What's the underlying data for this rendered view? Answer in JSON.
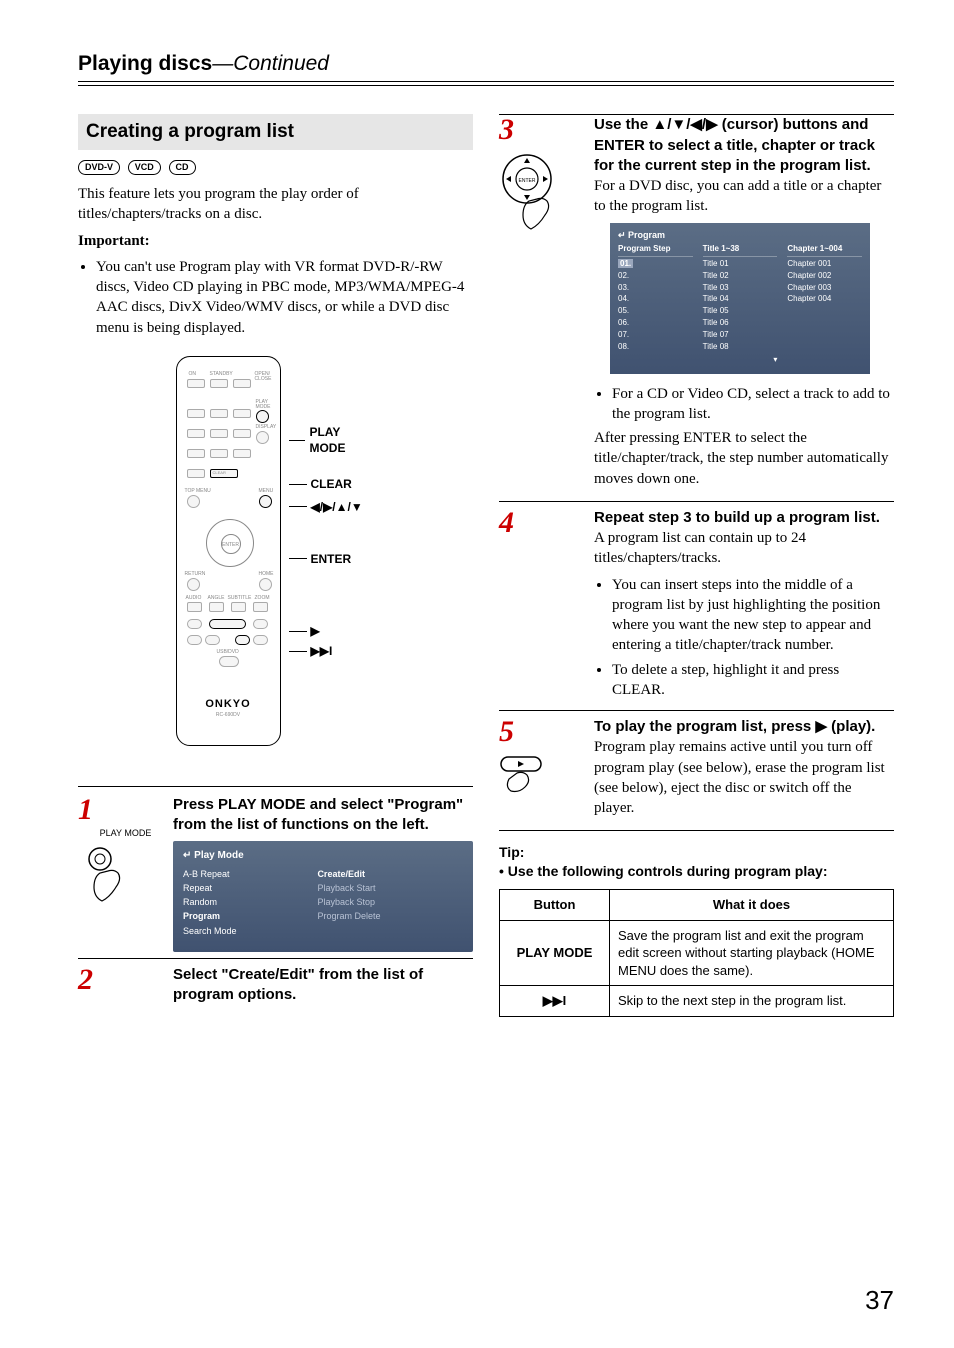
{
  "header": {
    "title": "Playing discs",
    "continued": "—Continued"
  },
  "section": {
    "title": "Creating a program list"
  },
  "badges": [
    "DVD-V",
    "VCD",
    "CD"
  ],
  "intro": "This feature lets you program the play order of titles/chapters/tracks on a disc.",
  "important_label": "Important:",
  "important_items": [
    "You can't use Program play with VR format DVD-R/-RW discs, Video CD playing in PBC mode, MP3/WMA/MPEG-4 AAC discs, DivX Video/WMV discs, or while a DVD disc menu is being displayed."
  ],
  "remote": {
    "brand": "ONKYO",
    "model": "RC-690DV",
    "labels": {
      "on": "ON",
      "standby": "STANDBY",
      "open_close": "OPEN/\nCLOSE",
      "play_mode": "PLAY\nMODE",
      "display": "DISPLAY",
      "clear": "CLEAR",
      "top_menu": "TOP MENU",
      "menu": "MENU",
      "return": "RETURN",
      "home": "HOME",
      "audio": "AUDIO",
      "angle": "ANGLE",
      "subtitle": "SUBTITLE",
      "zoom": "ZOOM",
      "usb": "USB/DVD",
      "enter": "ENTER"
    },
    "callouts": [
      "PLAY MODE",
      "CLEAR",
      "◀/▶/▲/▼",
      "ENTER",
      "▶",
      "▶▶I"
    ]
  },
  "steps": [
    {
      "num": "1",
      "icon_label": "PLAY MODE",
      "title": "Press PLAY MODE and select \"Program\" from the list of functions on the left.",
      "osd": {
        "header": "Play Mode",
        "left": [
          "A-B Repeat",
          "Repeat",
          "Random",
          "Program",
          "Search Mode"
        ],
        "left_selected": 3,
        "right": [
          "Create/Edit",
          "Playback Start",
          "Playback Stop",
          "Program Delete"
        ],
        "right_selected": 0,
        "right_dim": [
          1,
          2,
          3
        ]
      }
    },
    {
      "num": "2",
      "title": "Select \"Create/Edit\" from the list of program options."
    },
    {
      "num": "3",
      "title_prefix": "Use the ",
      "title_mid": " (cursor) buttons and ENTER to select a title, chapter or track for the current step in the program list.",
      "body1": "For a DVD disc, you can add a title or a chapter to the program list.",
      "osd": {
        "header": "Program",
        "col1_h": "Program Step",
        "col2_h": "Title 1~38",
        "col3_h": "Chapter 1~004",
        "rows": [
          [
            "01.",
            "Title 01",
            "Chapter 001"
          ],
          [
            "02.",
            "Title 02",
            "Chapter 002"
          ],
          [
            "03.",
            "Title 03",
            "Chapter 003"
          ],
          [
            "04.",
            "Title 04",
            "Chapter 004"
          ],
          [
            "05.",
            "Title 05",
            ""
          ],
          [
            "06.",
            "Title 06",
            ""
          ],
          [
            "07.",
            "Title 07",
            ""
          ],
          [
            "08.",
            "Title 08",
            ""
          ]
        ],
        "sel_row": 0
      },
      "bullet": "For a CD or Video CD, select a track to add to the program list.",
      "body2": "After pressing ENTER to select the title/chapter/track, the step number automatically moves down one."
    },
    {
      "num": "4",
      "title": "Repeat step 3 to build up a program list.",
      "body": "A program list can contain up to 24 titles/chapters/tracks.",
      "bullets": [
        "You can insert steps into the middle of a program list by just highlighting the position where you want the new step to appear and entering a title/chapter/track number.",
        "To delete a step, highlight it and press CLEAR."
      ]
    },
    {
      "num": "5",
      "title_prefix": "To play the program list, press ",
      "title_suffix": " (play).",
      "body": "Program play remains active until you turn off program play (see below), erase the program list (see below), eject the disc or switch off the player."
    }
  ],
  "tip_label": "Tip:",
  "tip_line": "Use the following controls during program play:",
  "table": {
    "headers": [
      "Button",
      "What it does"
    ],
    "rows": [
      [
        "PLAY MODE",
        "Save the program list and exit the program edit screen without starting playback (HOME MENU does the same)."
      ],
      [
        "▶▶I",
        "Skip to the next step in the program list."
      ]
    ]
  },
  "page_number": "37"
}
